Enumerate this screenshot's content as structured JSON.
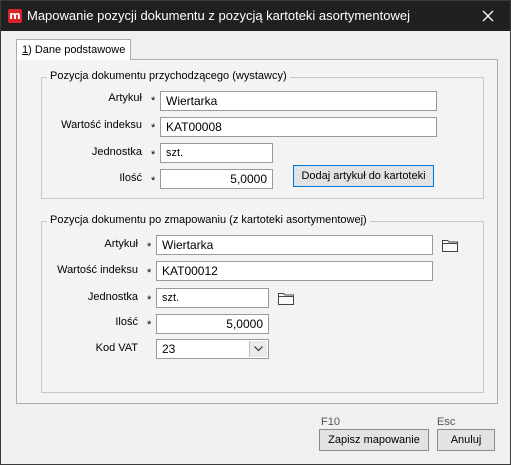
{
  "window": {
    "title": "Mapowanie pozycji dokumentu z pozycją kartoteki asortymentowej",
    "app_icon_letter": "m"
  },
  "tab": {
    "number": "1",
    "label": ") Dane podstawowe"
  },
  "source_group": {
    "title": "Pozycja dokumentu przychodzącego (wystawcy)",
    "artykul_label": "Artykuł",
    "artykul_value": "Wiertarka",
    "index_label": "Wartość indeksu",
    "index_value": "KAT00008",
    "unit_label": "Jednostka",
    "unit_value": "szt.",
    "qty_label": "Ilość",
    "qty_value": "5,0000",
    "add_button": "Dodaj artykuł do kartoteki"
  },
  "mapped_group": {
    "title": "Pozycja dokumentu po zmapowaniu (z kartoteki asortymentowej)",
    "artykul_label": "Artykuł",
    "artykul_value": "Wiertarka",
    "index_label": "Wartość indeksu",
    "index_value": "KAT00012",
    "unit_label": "Jednostka",
    "unit_value": "szt.",
    "qty_label": "Ilość",
    "qty_value": "5,0000",
    "vat_label": "Kod VAT",
    "vat_value": "23"
  },
  "required_marker": "*",
  "footer": {
    "save_key": "F10",
    "save_button": "Zapisz mapowanie",
    "cancel_key": "Esc",
    "cancel_button": "Anuluj"
  }
}
